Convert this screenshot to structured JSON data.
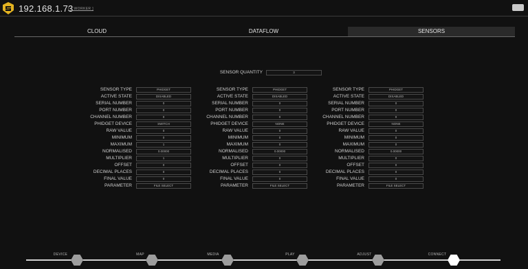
{
  "header": {
    "host": "192.168.1.73",
    "worker_link": "[ 1 WORKER ]"
  },
  "tabs": [
    {
      "label": "CLOUD",
      "active": false
    },
    {
      "label": "DATAFLOW",
      "active": false
    },
    {
      "label": "SENSORS",
      "active": true
    }
  ],
  "sensors": {
    "quantity_label": "SENSOR QUANTITY",
    "quantity_value": "3",
    "field_labels": [
      "SENSOR TYPE",
      "ACTIVE STATE",
      "SERIAL NUMBER",
      "PORT NUMBER",
      "CHANNEL NUMBER",
      "PHIDGET DEVICE",
      "RAW VALUE",
      "MINIMUM",
      "MAXIMUM",
      "NORMALISED",
      "MULTIPLIER",
      "OFFSET",
      "DECIMAL PLACES",
      "FINAL VALUE",
      "PARAMETER"
    ],
    "columns": [
      [
        "PHIDGET",
        "DISABLED",
        "0",
        "0",
        "0",
        "SWITCH",
        "0",
        "0",
        "1",
        "0.00000",
        "1",
        "0",
        "0",
        "0",
        "FILE SELECT"
      ],
      [
        "PHIDGET",
        "DISABLED",
        "0",
        "0",
        "0",
        "NONE",
        "0",
        "0",
        "0",
        "0.00000",
        "0",
        "0",
        "0",
        "0",
        "FILE SELECT"
      ],
      [
        "PHIDGET",
        "DISABLED",
        "0",
        "0",
        "0",
        "NONE",
        "0",
        "0",
        "0",
        "0.00000",
        "0",
        "0",
        "0",
        "0",
        "FILE SELECT"
      ]
    ]
  },
  "timeline": {
    "stages": [
      {
        "label": "DEVICE",
        "active": false
      },
      {
        "label": "MAP",
        "active": false
      },
      {
        "label": "MEDIA",
        "active": false
      },
      {
        "label": "PLAY",
        "active": false
      },
      {
        "label": "ADJUST",
        "active": false
      },
      {
        "label": "CONNECT",
        "active": true
      }
    ]
  },
  "colors": {
    "background": "#111111",
    "logo": "#e3b321",
    "inactive_hex": "#9d9d9d",
    "active_hex": "#ffffff"
  },
  "icons": {
    "logo": "shield-logo-icon",
    "window_button": "window-control-icon"
  }
}
